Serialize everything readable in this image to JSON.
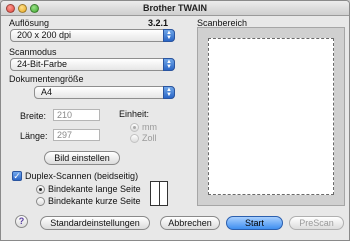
{
  "window": {
    "title": "Brother TWAIN"
  },
  "settings": {
    "resolution_label": "Auflösung",
    "version": "3.2.1",
    "resolution_value": "200 x 200 dpi",
    "scanmode_label": "Scanmodus",
    "scanmode_value": "24-Bit-Farbe",
    "docsize_label": "Dokumentengröße",
    "docsize_value": "A4",
    "width_label": "Breite:",
    "width_value": "210",
    "length_label": "Länge:",
    "length_value": "297",
    "unit_label": "Einheit:",
    "unit_mm": "mm",
    "unit_inch": "Zoll",
    "adjust_image_button": "Bild einstellen",
    "duplex_label": "Duplex-Scannen (beidseitig)",
    "binding_long": "Bindekante lange Seite",
    "binding_short": "Bindekante kurze Seite"
  },
  "preview": {
    "label": "Scanbereich"
  },
  "footer": {
    "help": "?",
    "defaults_button": "Standardeinstellungen",
    "cancel_button": "Abbrechen",
    "start_button": "Start",
    "prescan_button": "PreScan"
  },
  "state": {
    "unit_selected": "mm",
    "duplex_checked": true,
    "binding_selected": "long"
  },
  "icons": {
    "select_arrow": "updown-arrow-icon",
    "checkmark": "checkmark-icon"
  }
}
